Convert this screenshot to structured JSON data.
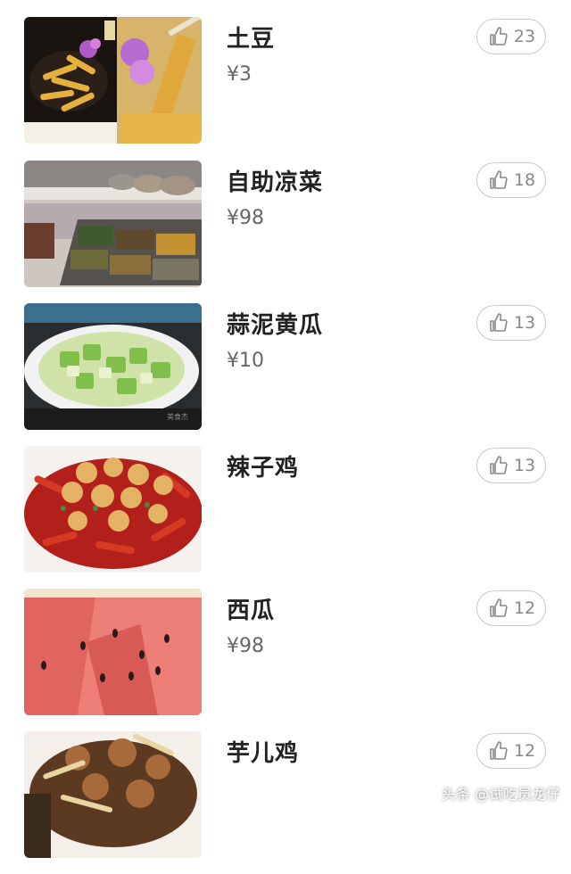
{
  "menu": {
    "items": [
      {
        "name": "土豆",
        "price": "¥3",
        "likes": "23",
        "photo": "fried-potato-photo"
      },
      {
        "name": "自助凉菜",
        "price": "¥98",
        "likes": "18",
        "photo": "buffet-cold-dishes-photo"
      },
      {
        "name": "蒜泥黄瓜",
        "price": "¥10",
        "likes": "13",
        "photo": "garlic-cucumber-photo"
      },
      {
        "name": "辣子鸡",
        "price": "",
        "likes": "13",
        "photo": "spicy-chicken-photo"
      },
      {
        "name": "西瓜",
        "price": "¥98",
        "likes": "12",
        "photo": "watermelon-photo"
      },
      {
        "name": "芋儿鸡",
        "price": "",
        "likes": "12",
        "photo": "taro-chicken-photo"
      }
    ]
  },
  "like_icon": "thumbs-up-icon",
  "watermark": "头条 @试吃员龙仔",
  "colors": {
    "name": "#222222",
    "price": "#666666",
    "like_border": "#c8c8c8",
    "like_text": "#888888"
  }
}
